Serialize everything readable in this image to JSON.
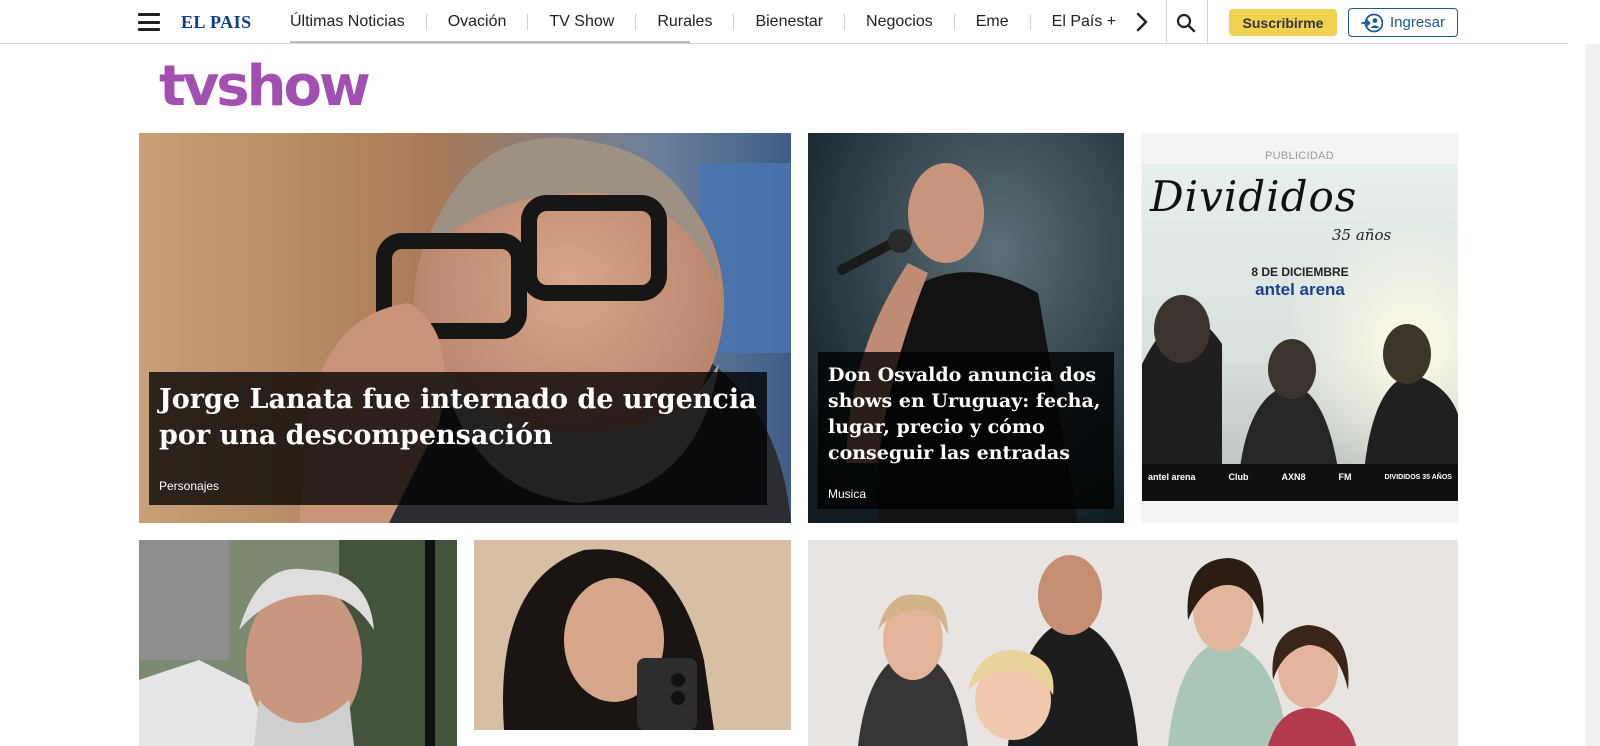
{
  "header": {
    "logo": "EL PAIS",
    "nav": [
      "Últimas Noticias",
      "Ovación",
      "TV Show",
      "Rurales",
      "Bienestar",
      "Negocios",
      "Eme",
      "El País +"
    ],
    "subscribe_label": "Suscribirme",
    "login_label": "Ingresar"
  },
  "section": {
    "logo": "tvshow"
  },
  "articles": [
    {
      "headline": "Jorge Lanata fue internado de urgencia por una descompensación",
      "tag": "Personajes"
    },
    {
      "headline": "Don Osvaldo anuncia dos shows en Uruguay: fecha, lugar, precio y cómo conseguir las entradas",
      "tag": "Musica"
    }
  ],
  "ad": {
    "label": "PUBLICIDAD",
    "brand_script": "Divididos",
    "years": "35 años",
    "date": "8 DE DICIEMBRE",
    "venue": "antel arena",
    "sponsors": [
      "antel arena",
      "Club",
      "AXN8",
      "FM",
      "DIVIDIDOS 35 AÑOS"
    ]
  },
  "colors": {
    "brand_blue": "#0d3c8c",
    "section_purple": "#a14fb0",
    "subscribe_yellow": "#f0d150"
  },
  "icons": [
    "hamburger-menu-icon",
    "chevron-right-icon",
    "search-icon",
    "login-user-icon"
  ]
}
